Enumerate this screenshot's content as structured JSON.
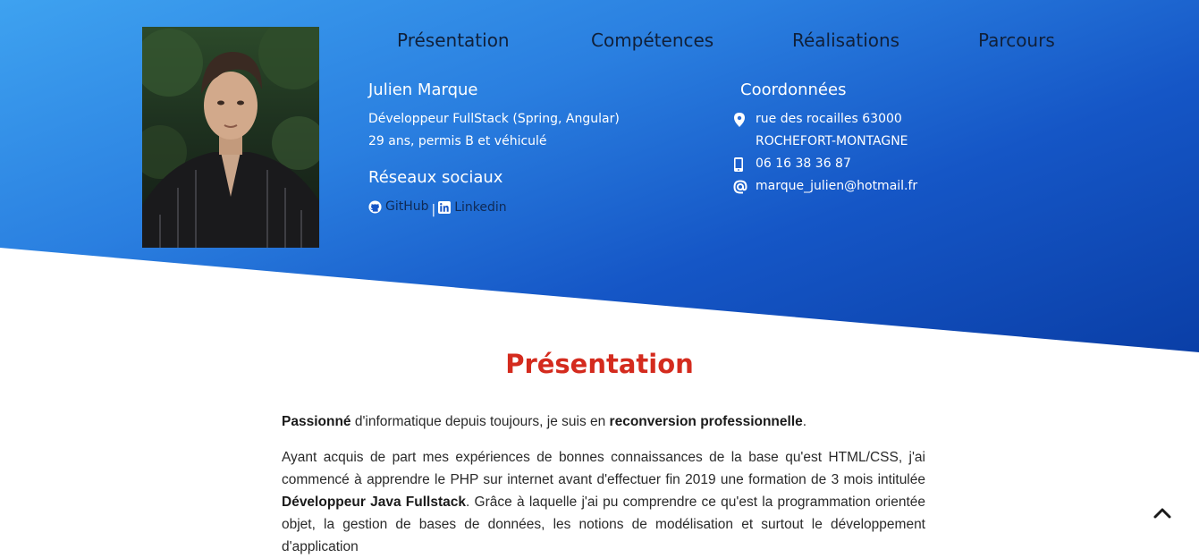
{
  "nav": {
    "items": [
      "Présentation",
      "Compétences",
      "Réalisations",
      "Parcours"
    ]
  },
  "profile": {
    "name": "Julien Marque",
    "role": "Développeur FullStack (Spring, Angular)",
    "details": "29 ans, permis B et véhiculé",
    "photo_alt": "Julien Marque"
  },
  "social": {
    "title": "Réseaux sociaux",
    "github_label": "GitHub",
    "separator": "|",
    "linkedin_label": "Linkedin"
  },
  "contact": {
    "title": "Coordonnées",
    "address_line1": "rue des rocailles 63000",
    "address_line2": "ROCHEFORT-MONTAGNE",
    "phone": "06 16 38 36 87",
    "email": "marque_julien@hotmail.fr"
  },
  "presentation": {
    "title": "Présentation",
    "p1_strong1": "Passionné",
    "p1_text1": " d'informatique depuis toujours, je suis en ",
    "p1_strong2": "reconversion professionnelle",
    "p1_text2": ".",
    "p2_text1": "Ayant acquis de part mes expériences de bonnes connaissances de la base qu'est HTML/CSS, j'ai commencé à apprendre le PHP sur internet avant d'effectuer fin 2019 une formation de 3 mois intitulée ",
    "p2_strong": "Développeur Java Fullstack",
    "p2_text2": ". Grâce à laquelle j'ai pu comprendre ce qu'est la programmation orientée objet, la gestion de bases de données, les notions de modélisation et surtout le développement d'application"
  },
  "colors": {
    "accent_red": "#d42b1e",
    "hero_light": "#3ea2f0",
    "hero_dark": "#0a3ea6"
  },
  "icons": [
    "map-marker-icon",
    "mobile-phone-icon",
    "at-sign-icon",
    "github-icon",
    "linkedin-icon",
    "chevron-up-icon"
  ]
}
